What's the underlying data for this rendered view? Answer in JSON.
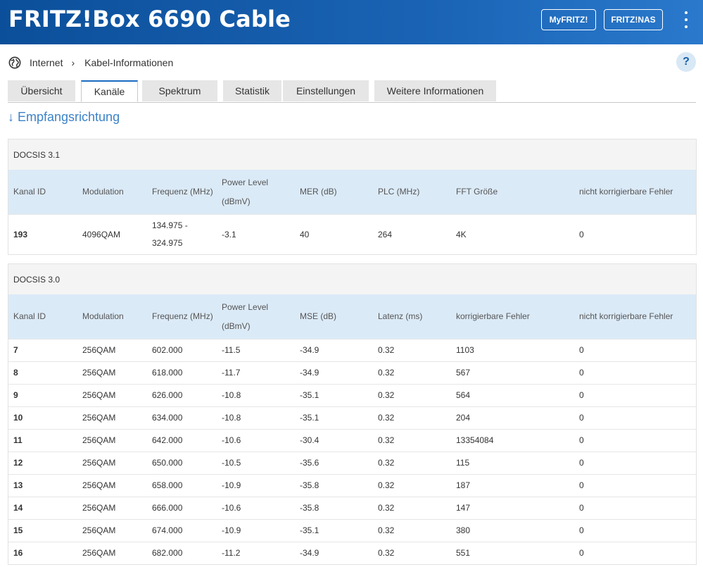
{
  "header": {
    "title": "FRITZ!Box 6690 Cable",
    "btn_myfritz": "MyFRITZ!",
    "btn_nas": "FRITZ!NAS"
  },
  "breadcrumb": {
    "item1": "Internet",
    "item2": "Kabel-Informationen"
  },
  "help_label": "?",
  "tabs": [
    "Übersicht",
    "Kanäle",
    "Spektrum",
    "Statistik",
    "Einstellungen",
    "Weitere Informationen"
  ],
  "active_tab": "Kanäle",
  "section_title": "↓ Empfangsrichtung",
  "docsis31": {
    "caption": "DOCSIS 3.1",
    "headers": [
      "Kanal ID",
      "Modulation",
      "Frequenz (MHz)",
      "Power Level (dBmV)",
      "MER (dB)",
      "PLC (MHz)",
      "FFT Größe",
      "nicht korrigierbare Fehler"
    ],
    "rows": [
      [
        "193",
        "4096QAM",
        "134.975 - 324.975",
        "-3.1",
        "40",
        "264",
        "4K",
        "0"
      ]
    ]
  },
  "docsis30": {
    "caption": "DOCSIS 3.0",
    "headers": [
      "Kanal ID",
      "Modulation",
      "Frequenz (MHz)",
      "Power Level (dBmV)",
      "MSE (dB)",
      "Latenz (ms)",
      "korrigierbare Fehler",
      "nicht korrigierbare Fehler"
    ],
    "rows": [
      [
        "7",
        "256QAM",
        "602.000",
        "-11.5",
        "-34.9",
        "0.32",
        "1103",
        "0"
      ],
      [
        "8",
        "256QAM",
        "618.000",
        "-11.7",
        "-34.9",
        "0.32",
        "567",
        "0"
      ],
      [
        "9",
        "256QAM",
        "626.000",
        "-10.8",
        "-35.1",
        "0.32",
        "564",
        "0"
      ],
      [
        "10",
        "256QAM",
        "634.000",
        "-10.8",
        "-35.1",
        "0.32",
        "204",
        "0"
      ],
      [
        "11",
        "256QAM",
        "642.000",
        "-10.6",
        "-30.4",
        "0.32",
        "13354084",
        "0"
      ],
      [
        "12",
        "256QAM",
        "650.000",
        "-10.5",
        "-35.6",
        "0.32",
        "115",
        "0"
      ],
      [
        "13",
        "256QAM",
        "658.000",
        "-10.9",
        "-35.8",
        "0.32",
        "187",
        "0"
      ],
      [
        "14",
        "256QAM",
        "666.000",
        "-10.6",
        "-35.8",
        "0.32",
        "147",
        "0"
      ],
      [
        "15",
        "256QAM",
        "674.000",
        "-10.9",
        "-35.1",
        "0.32",
        "380",
        "0"
      ],
      [
        "16",
        "256QAM",
        "682.000",
        "-11.2",
        "-34.9",
        "0.32",
        "551",
        "0"
      ]
    ]
  },
  "colors": {
    "header_bg": "#1a63b4",
    "table_header_bg": "#dbeaf7",
    "accent": "#3c82c8"
  }
}
